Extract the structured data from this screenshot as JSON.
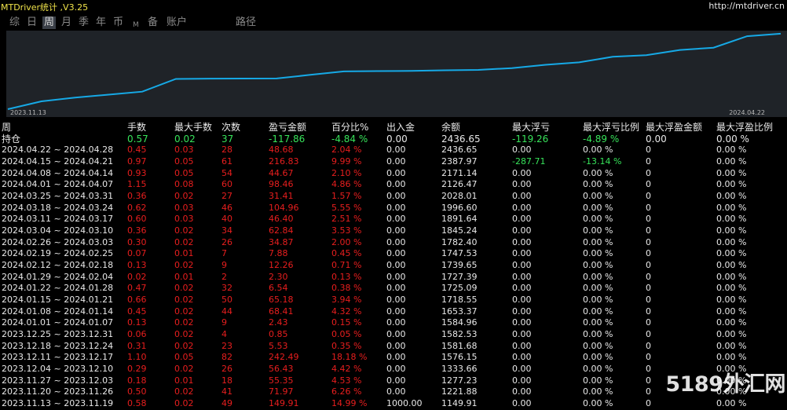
{
  "app": {
    "title": "MTDriver统计 ,V3.25",
    "url": "http://mtdriver.cn"
  },
  "nav": {
    "items": [
      {
        "label": "综"
      },
      {
        "label": "日"
      },
      {
        "label": "周",
        "active": true
      },
      {
        "label": "月"
      },
      {
        "label": "季"
      },
      {
        "label": "年"
      },
      {
        "label": "币"
      },
      {
        "label": "M"
      },
      {
        "label": "备"
      },
      {
        "label": "账户"
      },
      {
        "label": "路径"
      }
    ]
  },
  "chart_data": {
    "type": "line",
    "x_start_label": "2023.11.13",
    "x_end_label": "2024.04.22",
    "x": [
      "2023.11.13",
      "2023.11.20",
      "2023.11.27",
      "2023.12.04",
      "2023.12.11",
      "2023.12.18",
      "2023.12.25",
      "2024.01.01",
      "2024.01.08",
      "2024.01.15",
      "2024.01.22",
      "2024.01.29",
      "2024.02.05",
      "2024.02.12",
      "2024.02.19",
      "2024.02.26",
      "2024.03.04",
      "2024.03.11",
      "2024.03.18",
      "2024.03.25",
      "2024.04.01",
      "2024.04.08",
      "2024.04.15",
      "2024.04.22"
    ],
    "series": [
      {
        "values": [
          1000,
          1149.91,
          1221.88,
          1277.23,
          1333.66,
          1576.15,
          1581.68,
          1582.53,
          1584.96,
          1653.37,
          1718.55,
          1725.09,
          1727.39,
          1739.65,
          1747.53,
          1782.4,
          1845.24,
          1891.64,
          1996.6,
          2028.01,
          2126.47,
          2171.14,
          2387.97,
          2436.65
        ],
        "color": "#16a9e6"
      }
    ],
    "grid": false,
    "ylim": [
      1000,
      2450
    ]
  },
  "table": {
    "headers": [
      "周",
      "手数",
      "最大手数",
      "次数",
      "盈亏金额",
      "百分比%",
      "出入金",
      "余额",
      "最大浮亏",
      "最大浮亏比例",
      "最大浮盈金额",
      "最大浮盈比例"
    ],
    "open": [
      "持仓",
      "0.57",
      "0.02",
      "37",
      "-117.86",
      "-4.84 %",
      "0.00",
      "2436.65",
      "-119.26",
      "-4.89 %",
      "0.00",
      "0.00 %"
    ],
    "rows": [
      [
        "2024.04.22 ~ 2024.04.28",
        "0.45",
        "0.03",
        "28",
        "48.68",
        "2.04 %",
        "0.00",
        "2436.65",
        "0.00",
        "0.00 %",
        "0",
        "0.00 %"
      ],
      [
        "2024.04.15 ~ 2024.04.21",
        "0.97",
        "0.05",
        "61",
        "216.83",
        "9.99 %",
        "0.00",
        "2387.97",
        "-287.71",
        "-13.14 %",
        "0",
        "0.00 %"
      ],
      [
        "2024.04.08 ~ 2024.04.14",
        "0.93",
        "0.05",
        "54",
        "44.67",
        "2.10 %",
        "0.00",
        "2171.14",
        "0.00",
        "0.00 %",
        "0",
        "0.00 %"
      ],
      [
        "2024.04.01 ~ 2024.04.07",
        "1.15",
        "0.08",
        "60",
        "98.46",
        "4.86 %",
        "0.00",
        "2126.47",
        "0.00",
        "0.00 %",
        "0",
        "0.00 %"
      ],
      [
        "2024.03.25 ~ 2024.03.31",
        "0.36",
        "0.02",
        "27",
        "31.41",
        "1.57 %",
        "0.00",
        "2028.01",
        "0.00",
        "0.00 %",
        "0",
        "0.00 %"
      ],
      [
        "2024.03.18 ~ 2024.03.24",
        "0.62",
        "0.03",
        "46",
        "104.96",
        "5.55 %",
        "0.00",
        "1996.60",
        "0.00",
        "0.00 %",
        "0",
        "0.00 %"
      ],
      [
        "2024.03.11 ~ 2024.03.17",
        "0.60",
        "0.03",
        "40",
        "46.40",
        "2.51 %",
        "0.00",
        "1891.64",
        "0.00",
        "0.00 %",
        "0",
        "0.00 %"
      ],
      [
        "2024.03.04 ~ 2024.03.10",
        "0.36",
        "0.02",
        "34",
        "62.84",
        "3.53 %",
        "0.00",
        "1845.24",
        "0.00",
        "0.00 %",
        "0",
        "0.00 %"
      ],
      [
        "2024.02.26 ~ 2024.03.03",
        "0.30",
        "0.02",
        "26",
        "34.87",
        "2.00 %",
        "0.00",
        "1782.40",
        "0.00",
        "0.00 %",
        "0",
        "0.00 %"
      ],
      [
        "2024.02.19 ~ 2024.02.25",
        "0.07",
        "0.01",
        "7",
        "7.88",
        "0.45 %",
        "0.00",
        "1747.53",
        "0.00",
        "0.00 %",
        "0",
        "0.00 %"
      ],
      [
        "2024.02.12 ~ 2024.02.18",
        "0.13",
        "0.02",
        "9",
        "12.26",
        "0.71 %",
        "0.00",
        "1739.65",
        "0.00",
        "0.00 %",
        "0",
        "0.00 %"
      ],
      [
        "2024.01.29 ~ 2024.02.04",
        "0.02",
        "0.01",
        "2",
        "2.30",
        "0.13 %",
        "0.00",
        "1727.39",
        "0.00",
        "0.00 %",
        "0",
        "0.00 %"
      ],
      [
        "2024.01.22 ~ 2024.01.28",
        "0.47",
        "0.02",
        "32",
        "6.54",
        "0.38 %",
        "0.00",
        "1725.09",
        "0.00",
        "0.00 %",
        "0",
        "0.00 %"
      ],
      [
        "2024.01.15 ~ 2024.01.21",
        "0.66",
        "0.02",
        "50",
        "65.18",
        "3.94 %",
        "0.00",
        "1718.55",
        "0.00",
        "0.00 %",
        "0",
        "0.00 %"
      ],
      [
        "2024.01.08 ~ 2024.01.14",
        "0.45",
        "0.02",
        "44",
        "68.41",
        "4.32 %",
        "0.00",
        "1653.37",
        "0.00",
        "0.00 %",
        "0",
        "0.00 %"
      ],
      [
        "2024.01.01 ~ 2024.01.07",
        "0.13",
        "0.02",
        "9",
        "2.43",
        "0.15 %",
        "0.00",
        "1584.96",
        "0.00",
        "0.00 %",
        "0",
        "0.00 %"
      ],
      [
        "2023.12.25 ~ 2023.12.31",
        "0.06",
        "0.02",
        "4",
        "0.85",
        "0.05 %",
        "0.00",
        "1582.53",
        "0.00",
        "0.00 %",
        "0",
        "0.00 %"
      ],
      [
        "2023.12.18 ~ 2023.12.24",
        "0.31",
        "0.02",
        "23",
        "5.53",
        "0.35 %",
        "0.00",
        "1581.68",
        "0.00",
        "0.00 %",
        "0",
        "0.00 %"
      ],
      [
        "2023.12.11 ~ 2023.12.17",
        "1.10",
        "0.05",
        "82",
        "242.49",
        "18.18 %",
        "0.00",
        "1576.15",
        "0.00",
        "0.00 %",
        "0",
        "0.00 %"
      ],
      [
        "2023.12.04 ~ 2023.12.10",
        "0.29",
        "0.02",
        "26",
        "56.43",
        "4.42 %",
        "0.00",
        "1333.66",
        "0.00",
        "0.00 %",
        "0",
        "0.00 %"
      ],
      [
        "2023.11.27 ~ 2023.12.03",
        "0.18",
        "0.01",
        "18",
        "55.35",
        "4.53 %",
        "0.00",
        "1277.23",
        "0.00",
        "0.00 %",
        "0",
        "0.00 %"
      ],
      [
        "2023.11.20 ~ 2023.11.26",
        "0.50",
        "0.02",
        "41",
        "71.97",
        "6.26 %",
        "0.00",
        "1221.88",
        "0.00",
        "0.00 %",
        "0",
        "0.00 %"
      ],
      [
        "2023.11.13 ~ 2023.11.19",
        "0.58",
        "0.02",
        "49",
        "149.91",
        "14.99 %",
        "1000.00",
        "1149.91",
        "0.00",
        "0.00 %",
        "0",
        "0.00 %"
      ]
    ]
  },
  "watermark": "5189外汇网"
}
